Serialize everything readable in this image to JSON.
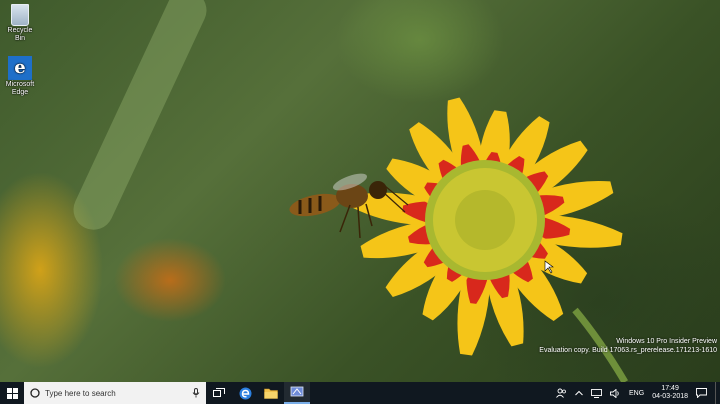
{
  "desktop": {
    "icons": [
      {
        "label": "Recycle Bin",
        "icon": "recycle-bin-icon"
      },
      {
        "label_line1": "Microsoft",
        "label_line2": "Edge",
        "icon": "edge-icon"
      }
    ],
    "watermark": {
      "line1": "Windows 10 Pro Insider Preview",
      "line2": "Evaluation copy. Build 17063.rs_prerelease.171213-1610"
    }
  },
  "taskbar": {
    "search_placeholder": "Type here to search",
    "pinned": [
      {
        "name": "task-view",
        "icon": "task-view-icon"
      },
      {
        "name": "edge",
        "icon": "edge-icon"
      },
      {
        "name": "file-explorer",
        "icon": "folder-icon"
      },
      {
        "name": "app",
        "icon": "app-icon",
        "active": true
      }
    ],
    "tray": {
      "language": "ENG",
      "time": "17:49",
      "date": "04-03-2018"
    }
  },
  "colors": {
    "taskbar_bg": "#101820",
    "accent": "#1e6fc9",
    "flower_red": "#d8281c",
    "flower_yellow": "#f5c518"
  }
}
